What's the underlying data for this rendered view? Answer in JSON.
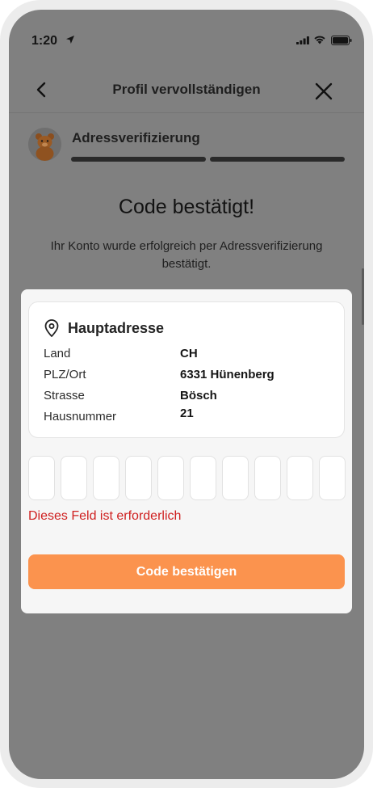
{
  "status_bar": {
    "time": "1:20",
    "icons": [
      "location-arrow-icon",
      "signal-icon",
      "wifi-icon",
      "battery-icon"
    ]
  },
  "header": {
    "title": "Profil vervollständigen",
    "back_icon": "chevron-left-icon",
    "close_icon": "close-icon"
  },
  "progress": {
    "step_label": "Adressverifizierung",
    "segments_total": 2,
    "segments_completed": 2
  },
  "confirmation": {
    "headline": "Code bestätigt!",
    "message": "Ihr Konto wurde erfolgreich per Adressverifizierung bestätigt."
  },
  "address_card": {
    "icon": "location-pin-icon",
    "title": "Hauptadresse",
    "rows": [
      {
        "label": "Land",
        "value": "CH"
      },
      {
        "label": "PLZ/Ort",
        "value": "6331 Hünenberg"
      },
      {
        "label": "Strasse",
        "value": "Bösch"
      },
      {
        "label": "Hausnummer",
        "value": "21"
      }
    ]
  },
  "code_input": {
    "digits": [
      "",
      "",
      "",
      "",
      "",
      "",
      "",
      "",
      "",
      ""
    ],
    "error": "Dieses Feld ist erforderlich"
  },
  "submit_button": {
    "label": "Code bestätigen"
  },
  "colors": {
    "accent": "#fb934e",
    "error": "#cf1f1f",
    "overlay": "#808080",
    "modal_bg": "#f6f6f6"
  }
}
